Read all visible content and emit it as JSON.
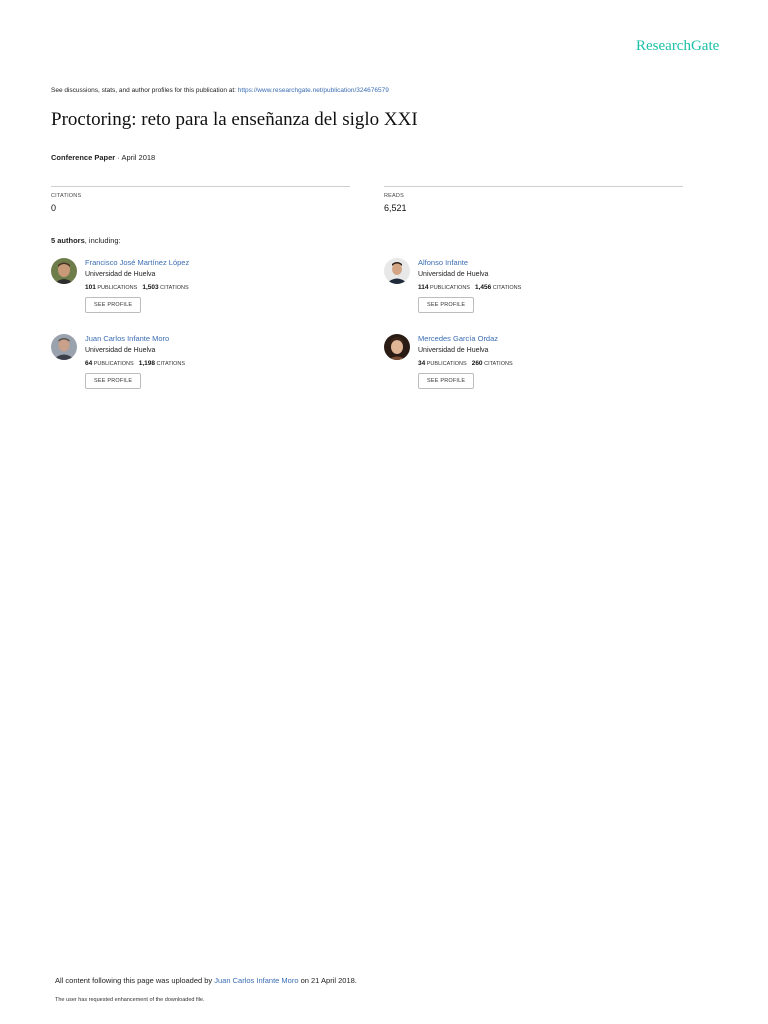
{
  "header": {
    "logo": "ResearchGate"
  },
  "discussion": {
    "prefix": "See discussions, stats, and author profiles for this publication at: ",
    "link": "https://www.researchgate.net/publication/324676579"
  },
  "publication": {
    "title": "Proctoring: reto para la enseñanza del siglo XXI",
    "type": "Conference Paper",
    "date": " · April 2018"
  },
  "stats": {
    "citations_label": "CITATIONS",
    "citations_value": "0",
    "reads_label": "READS",
    "reads_value": "6,521"
  },
  "authors_header": {
    "count": "5 authors",
    "suffix": ", including:"
  },
  "authors": [
    {
      "name": "Francisco José Martínez López",
      "institution": "Universidad de Huelva",
      "publications": "101",
      "publications_label": "PUBLICATIONS",
      "citations": "1,503",
      "citations_label": "CITATIONS",
      "button": "SEE PROFILE"
    },
    {
      "name": "Alfonso Infante",
      "institution": "Universidad de Huelva",
      "publications": "114",
      "publications_label": "PUBLICATIONS",
      "citations": "1,456",
      "citations_label": "CITATIONS",
      "button": "SEE PROFILE"
    },
    {
      "name": "Juan Carlos Infante Moro",
      "institution": "Universidad de Huelva",
      "publications": "64",
      "publications_label": "PUBLICATIONS",
      "citations": "1,198",
      "citations_label": "CITATIONS",
      "button": "SEE PROFILE"
    },
    {
      "name": "Mercedes García Ordaz",
      "institution": "Universidad de Huelva",
      "publications": "34",
      "publications_label": "PUBLICATIONS",
      "citations": "260",
      "citations_label": "CITATIONS",
      "button": "SEE PROFILE"
    }
  ],
  "footer": {
    "upload_prefix": "All content following this page was uploaded by ",
    "uploader": "Juan Carlos Infante Moro",
    "upload_suffix": " on 21 April 2018.",
    "enhancement": "The user has requested enhancement of the downloaded file."
  },
  "colors": {
    "brand": "#1bc1a8",
    "link": "#3b6db3",
    "divider": "#cfcfcf"
  }
}
